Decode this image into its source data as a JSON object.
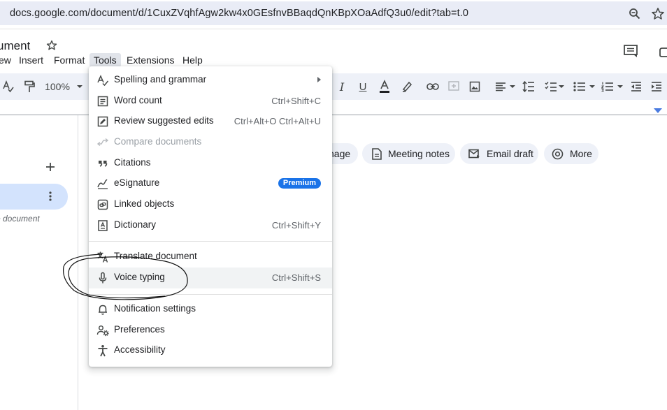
{
  "browser": {
    "url": "docs.google.com/document/d/1CuxZVqhfAgw2kw4x0GEsfnvBBaqdQnKBpXOaAdfQ3u0/edit?tab=t.0"
  },
  "doc": {
    "title_partial": "ument"
  },
  "menubar": {
    "items": [
      "ew",
      "Insert",
      "Format",
      "Tools",
      "Extensions",
      "Help"
    ],
    "active": "Tools"
  },
  "toolbar": {
    "zoom": "100%"
  },
  "outline": {
    "hint_partial": "e document"
  },
  "chips": [
    {
      "label": "nage",
      "icon": "image-icon"
    },
    {
      "label": "Meeting notes",
      "icon": "document-icon"
    },
    {
      "label": "Email draft",
      "icon": "email-icon"
    },
    {
      "label": "More",
      "icon": "at-sign-icon"
    }
  ],
  "tools_menu": {
    "items": [
      {
        "label": "Spelling and grammar",
        "icon": "spellcheck-icon",
        "shortcut": "",
        "submenu": true
      },
      {
        "label": "Word count",
        "icon": "word-count-icon",
        "shortcut": "Ctrl+Shift+C"
      },
      {
        "label": "Review suggested edits",
        "icon": "review-edits-icon",
        "shortcut": "Ctrl+Alt+O Ctrl+Alt+U"
      },
      {
        "label": "Compare documents",
        "icon": "compare-icon",
        "shortcut": "",
        "disabled": true
      },
      {
        "label": "Citations",
        "icon": "quote-icon",
        "shortcut": ""
      },
      {
        "label": "eSignature",
        "icon": "signature-icon",
        "badge": "Premium"
      },
      {
        "label": "Linked objects",
        "icon": "link-objects-icon",
        "shortcut": ""
      },
      {
        "label": "Dictionary",
        "icon": "dictionary-icon",
        "shortcut": "Ctrl+Shift+Y"
      },
      {
        "label": "Translate document",
        "icon": "translate-icon",
        "shortcut": ""
      },
      {
        "label": "Voice typing",
        "icon": "microphone-icon",
        "shortcut": "Ctrl+Shift+S",
        "highlighted": true
      },
      {
        "label": "Notification settings",
        "icon": "bell-icon",
        "shortcut": ""
      },
      {
        "label": "Preferences",
        "icon": "preferences-icon",
        "shortcut": ""
      },
      {
        "label": "Accessibility",
        "icon": "accessibility-icon",
        "shortcut": ""
      }
    ]
  },
  "colors": {
    "accent_blue": "#1a73e8",
    "toolbar_bg": "#eef1f8",
    "highlight_row": "#f1f3f4",
    "tab_pill": "#d3e3fd"
  }
}
